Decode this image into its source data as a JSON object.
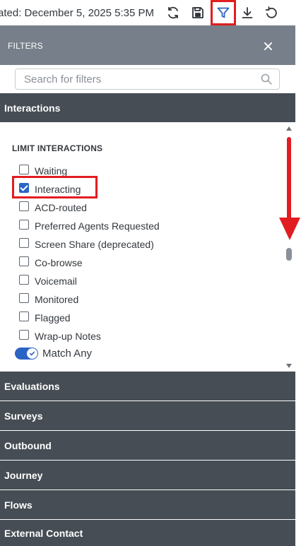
{
  "toolbar": {
    "updated_text": "ated: December 5, 2025 5:35 PM",
    "icons": [
      "refresh-icon",
      "save-icon",
      "filter-icon",
      "download-icon",
      "undo-icon"
    ]
  },
  "filters": {
    "title": "FILTERS",
    "search_placeholder": "Search for filters"
  },
  "sections": {
    "interactions": "Interactions",
    "others": [
      "Evaluations",
      "Surveys",
      "Outbound",
      "Journey",
      "Flows",
      "External Contact"
    ]
  },
  "limit": {
    "title": "LIMIT INTERACTIONS",
    "options": [
      {
        "label": "Waiting",
        "checked": false
      },
      {
        "label": "Interacting",
        "checked": true
      },
      {
        "label": "ACD-routed",
        "checked": false
      },
      {
        "label": "Preferred Agents Requested",
        "checked": false
      },
      {
        "label": "Screen Share (deprecated)",
        "checked": false
      },
      {
        "label": "Co-browse",
        "checked": false
      },
      {
        "label": "Voicemail",
        "checked": false
      },
      {
        "label": "Monitored",
        "checked": false
      },
      {
        "label": "Flagged",
        "checked": false
      },
      {
        "label": "Wrap-up Notes",
        "checked": false
      }
    ],
    "match_any_label": "Match Any",
    "match_any_on": true
  },
  "colors": {
    "header": "#77808a",
    "section": "#464d54",
    "accent": "#2a64c5",
    "annotation": "#e11d21"
  }
}
